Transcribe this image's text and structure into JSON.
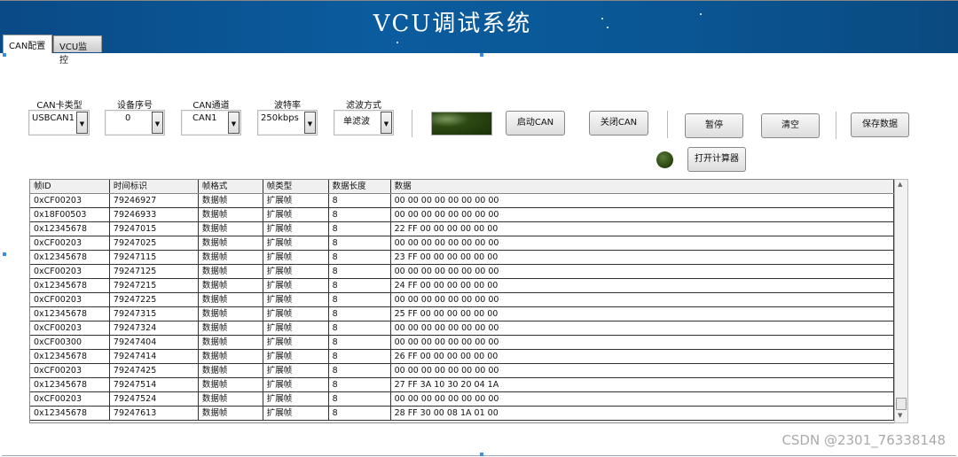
{
  "header": {
    "title": "VCU调试系统"
  },
  "tabs": [
    {
      "label": "CAN配置",
      "active": true
    },
    {
      "label": "VCU监控",
      "active": false
    }
  ],
  "config": {
    "can_card_type": {
      "label": "CAN卡类型",
      "value": "USBCAN1"
    },
    "device_index": {
      "label": "设备序号",
      "value": "0"
    },
    "can_channel": {
      "label": "CAN通道",
      "value": "CAN1"
    },
    "baud_rate": {
      "label": "波特率",
      "value": "250kbps"
    },
    "filter_mode": {
      "label": "滤波方式",
      "value": "单滤波"
    }
  },
  "buttons": {
    "start_can": "启动CAN",
    "close_can": "关闭CAN",
    "pause": "暂停",
    "clear": "清空",
    "save_data": "保存数据",
    "open_calculator": "打开计算器"
  },
  "indicator_color": "#2d4a12",
  "table": {
    "columns": [
      "帧ID",
      "时间标识",
      "帧格式",
      "帧类型",
      "数据长度",
      "数据"
    ],
    "rows": [
      [
        "0xCF00203",
        "79246927",
        "数据帧",
        "扩展帧",
        "8",
        "00 00 00 00 00 00 00 00"
      ],
      [
        "0x18F00503",
        "79246933",
        "数据帧",
        "扩展帧",
        "8",
        "00 00 00 00 00 00 00 00"
      ],
      [
        "0x12345678",
        "79247015",
        "数据帧",
        "扩展帧",
        "8",
        "22 FF 00 00 00 00 00 00"
      ],
      [
        "0xCF00203",
        "79247025",
        "数据帧",
        "扩展帧",
        "8",
        "00 00 00 00 00 00 00 00"
      ],
      [
        "0x12345678",
        "79247115",
        "数据帧",
        "扩展帧",
        "8",
        "23 FF 00 00 00 00 00 00"
      ],
      [
        "0xCF00203",
        "79247125",
        "数据帧",
        "扩展帧",
        "8",
        "00 00 00 00 00 00 00 00"
      ],
      [
        "0x12345678",
        "79247215",
        "数据帧",
        "扩展帧",
        "8",
        "24 FF 00 00 00 00 00 00"
      ],
      [
        "0xCF00203",
        "79247225",
        "数据帧",
        "扩展帧",
        "8",
        "00 00 00 00 00 00 00 00"
      ],
      [
        "0x12345678",
        "79247315",
        "数据帧",
        "扩展帧",
        "8",
        "25 FF 00 00 00 00 00 00"
      ],
      [
        "0xCF00203",
        "79247324",
        "数据帧",
        "扩展帧",
        "8",
        "00 00 00 00 00 00 00 00"
      ],
      [
        "0xCF00300",
        "79247404",
        "数据帧",
        "扩展帧",
        "8",
        "00 00 00 00 00 00 00 00"
      ],
      [
        "0x12345678",
        "79247414",
        "数据帧",
        "扩展帧",
        "8",
        "26 FF 00 00 00 00 00 00"
      ],
      [
        "0xCF00203",
        "79247425",
        "数据帧",
        "扩展帧",
        "8",
        "00 00 00 00 00 00 00 00"
      ],
      [
        "0x12345678",
        "79247514",
        "数据帧",
        "扩展帧",
        "8",
        "27 FF 3A 10 30 20 04 1A"
      ],
      [
        "0xCF00203",
        "79247524",
        "数据帧",
        "扩展帧",
        "8",
        "00 00 00 00 00 00 00 00"
      ],
      [
        "0x12345678",
        "79247613",
        "数据帧",
        "扩展帧",
        "8",
        "28 FF 30 00 08 1A 01 00"
      ]
    ]
  },
  "watermark": "CSDN @2301_76338148"
}
